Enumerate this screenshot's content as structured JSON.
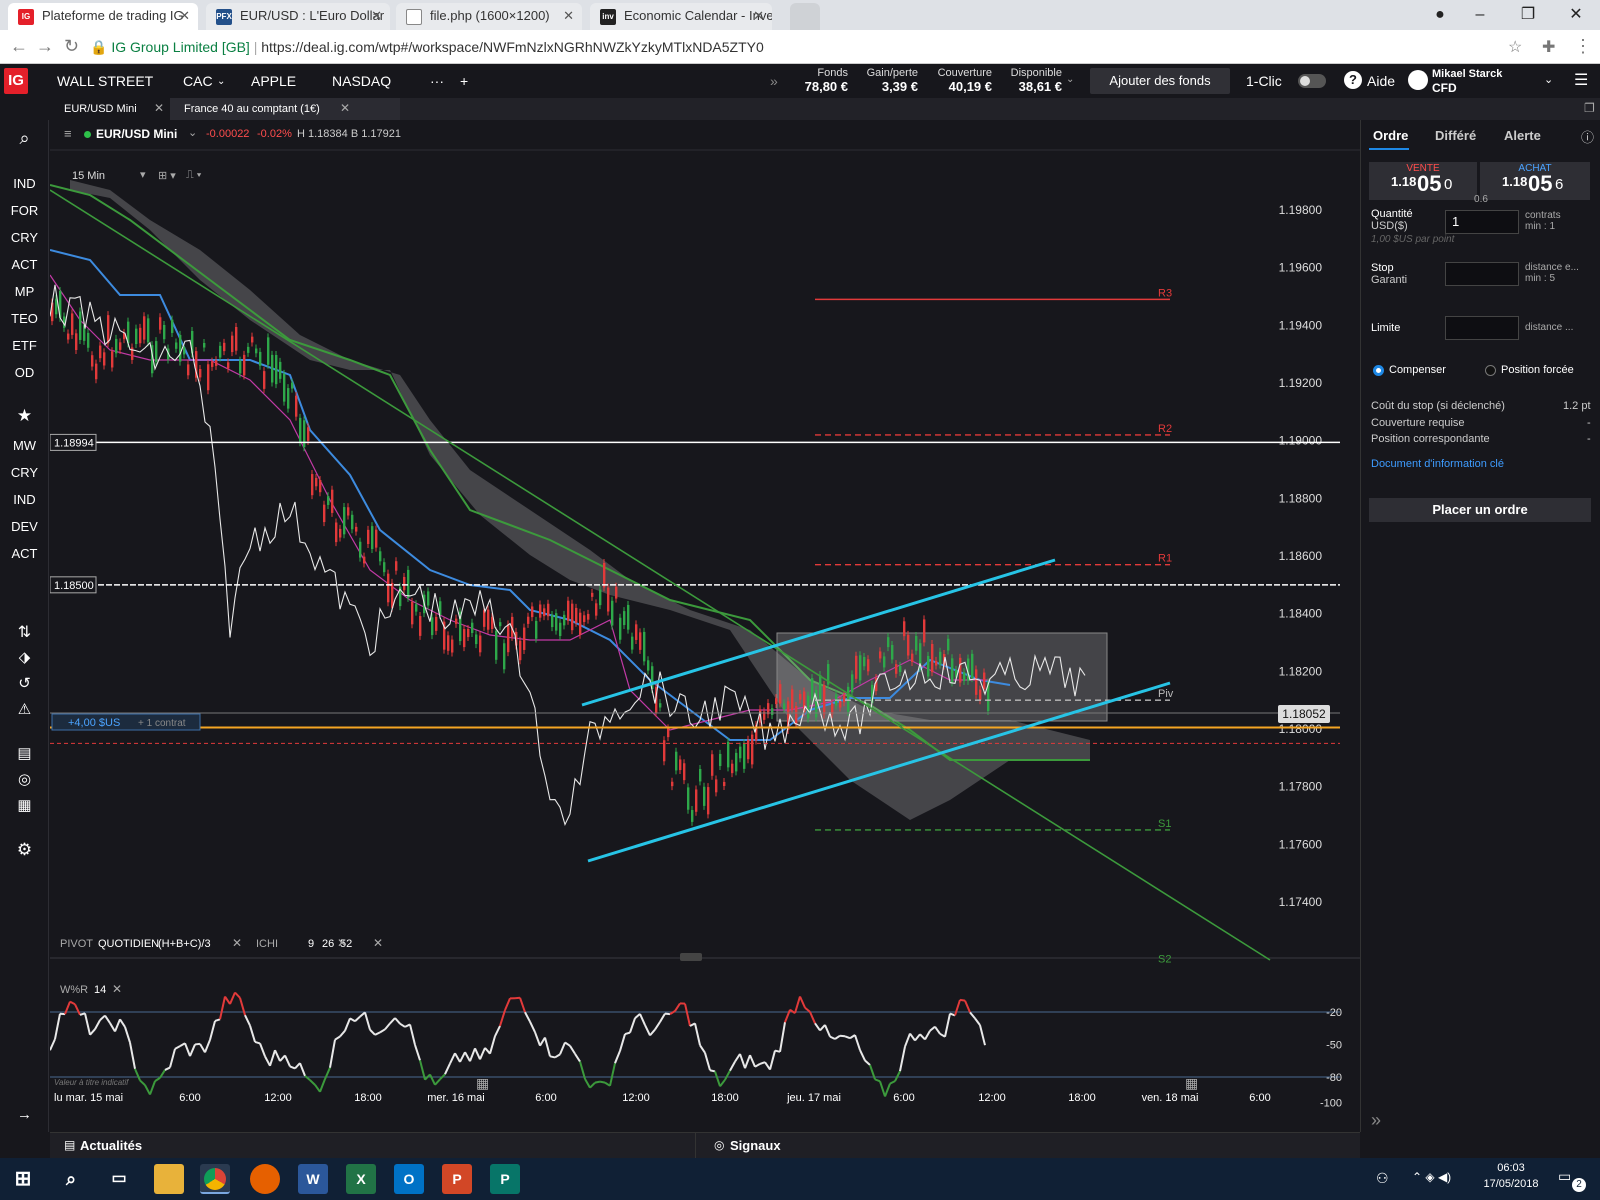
{
  "browser": {
    "tabs": [
      {
        "title": "Plateforme de trading IG",
        "favicon": "IG"
      },
      {
        "title": "EUR/USD : L'Euro Dollar",
        "favicon": "PFX"
      },
      {
        "title": "file.php (1600×1200)",
        "favicon": "doc"
      },
      {
        "title": "Economic Calendar - Inve",
        "favicon": "inv"
      }
    ],
    "site_name": "IG Group Limited [GB]",
    "url": "https://deal.ig.com/wtp#/workspace/NWFmNzlxNGRhNWZkYzkyMTlxNDA5ZTY0"
  },
  "header": {
    "markets": [
      "WALL STREET",
      "CAC",
      "APPLE",
      "NASDAQ"
    ],
    "more": "···",
    "add": "+",
    "funds_label": "Fonds",
    "funds_value": "78,80 €",
    "pnl_label": "Gain/perte",
    "pnl_value": "3,39 €",
    "margin_label": "Couverture",
    "margin_value": "40,19 €",
    "available_label": "Disponible",
    "available_value": "38,61 €",
    "add_funds": "Ajouter des fonds",
    "one_click": "1-Clic",
    "help": "Aide",
    "user_name": "Mikael Starck",
    "account_type": "CFD"
  },
  "workspace_tabs": [
    "EUR/USD Mini",
    "France 40 au comptant (1€)"
  ],
  "sidebar": {
    "top": [
      "IND",
      "FOR",
      "CRY",
      "ACT",
      "MP",
      "TEO",
      "ETF",
      "OD"
    ],
    "watch": [
      "MW",
      "CRY",
      "IND",
      "DEV",
      "ACT"
    ]
  },
  "chart_header": {
    "instrument": "EUR/USD Mini",
    "change": "-0.00022",
    "change_pct": "-0.02%",
    "high_low": "H 1.18384 B 1.17921",
    "interval": "15 Min"
  },
  "chart_data": {
    "type": "line",
    "y_ticks": [
      "1.19800",
      "1.19600",
      "1.19400",
      "1.19200",
      "1.19000",
      "1.18800",
      "1.18600",
      "1.18400",
      "1.18200",
      "1.18000",
      "1.17800",
      "1.17600",
      "1.17400"
    ],
    "x_ticks": [
      "lu mar. 15 mai",
      "6:00",
      "12:00",
      "18:00",
      "mer. 16 mai",
      "6:00",
      "12:00",
      "18:00",
      "jeu. 17 mai",
      "6:00",
      "12:00",
      "18:00",
      "ven. 18 mai",
      "6:00"
    ],
    "price_marker": "1.18052",
    "level_labels": [
      "1.18994",
      "1.18500"
    ],
    "pivots": {
      "R3": 1.1949,
      "R2": 1.1902,
      "R1": 1.1857,
      "Piv": 1.181,
      "S1": 1.1765,
      "S2": 1.1718
    },
    "pivot_names": [
      "R3",
      "R2",
      "R1",
      "Piv",
      "S1",
      "S2"
    ],
    "position_label": "+4,00 $US",
    "position_contracts": "+ 1 contrat",
    "indicators_label": [
      "PIVOT",
      "QUOTIDIEN",
      "(H+B+C)/3",
      "ICHI",
      "9",
      "26",
      "52"
    ],
    "wr_label": "W%R",
    "wr_period": "14",
    "wr_ticks": [
      "-20",
      "-50",
      "-80",
      "-100"
    ],
    "disclaimer": "Valeur à titre indicatif"
  },
  "order_panel": {
    "tabs": [
      "Ordre",
      "Différé",
      "Alerte"
    ],
    "sell_label": "VENTE",
    "sell_big": "1.18",
    "sell_main": "05",
    "sell_tail": "0",
    "buy_label": "ACHAT",
    "buy_big": "1.18",
    "buy_main": "05",
    "buy_tail": "6",
    "spread": "0.6",
    "qty_label": "Quantité",
    "qty_currency": "USD($)",
    "qty_value": "1",
    "qty_unit": "contrats",
    "qty_min": "min : 1",
    "per_point": "1,00 $US par point",
    "stop_label": "Stop",
    "stop_sub": "Garanti",
    "stop_unit": "distance e...",
    "stop_min": "min : 5",
    "limit_label": "Limite",
    "limit_unit": "distance ...",
    "opt1": "Compenser",
    "opt2": "Position forcée",
    "cost_label": "Coût du stop (si déclenché)",
    "cost_value": "1.2 pt",
    "margin_req": "Couverture requise",
    "margin_req_v": "-",
    "pos_corr": "Position correspondante",
    "pos_corr_v": "-",
    "kid": "Document d'information clé",
    "place": "Placer un ordre"
  },
  "bottom": {
    "news": "Actualités",
    "signals": "Signaux"
  },
  "taskbar": {
    "time": "06:03",
    "date": "17/05/2018",
    "badge": "2"
  }
}
